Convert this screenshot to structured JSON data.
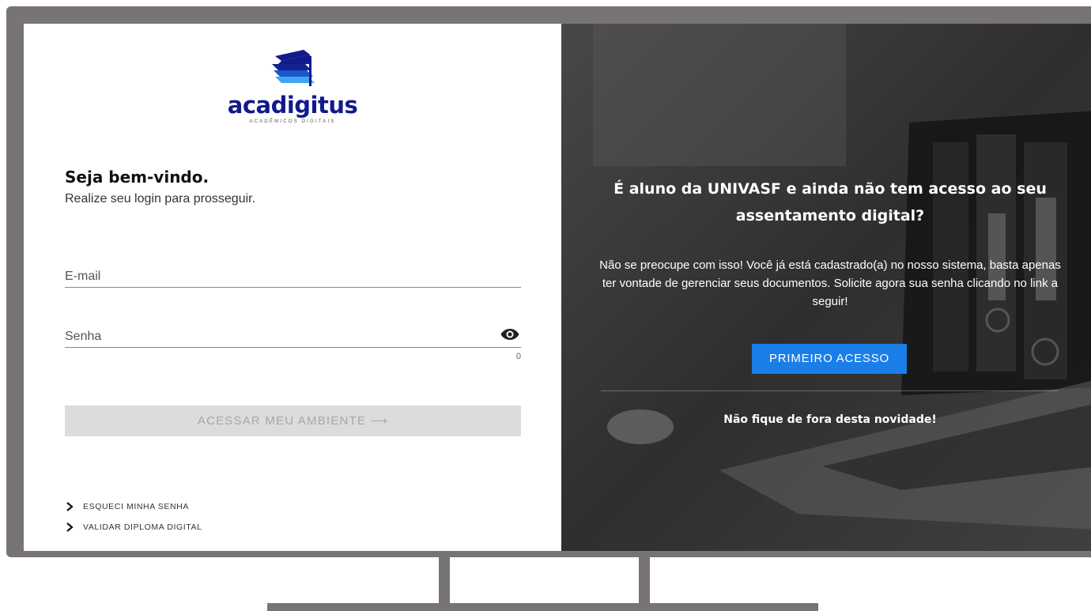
{
  "brand": {
    "name": "acadigitus",
    "tagline": "ACADÊMICOS DIGITAIS",
    "primary_color": "#111a8c",
    "accent_color": "#2f8fe8"
  },
  "login": {
    "title": "Seja bem-vindo.",
    "subtitle": "Realize seu login para prosseguir.",
    "email_placeholder": "E-mail",
    "password_placeholder": "Senha",
    "password_char_count": "0",
    "submit_label": "ACESSAR MEU AMBIENTE ⟶",
    "links": [
      {
        "label": "ESQUECI MINHA SENHA"
      },
      {
        "label": "VALIDAR DIPLOMA DIGITAL"
      }
    ]
  },
  "promo": {
    "title": "É aluno da UNIVASF e ainda não tem acesso ao seu assentamento digital?",
    "text": "Não se preocupe com isso! Você já está cadastrado(a) no nosso sistema, basta apenas ter vontade de gerenciar seus documentos. Solicite agora sua senha clicando no link a seguir!",
    "button_label": "PRIMEIRO ACESSO",
    "button_color": "#1a7ee8",
    "footer": "Não fique de fora desta novidade!"
  },
  "icons": {
    "password_toggle": "eye-icon",
    "link_marker": "chevron-right-icon"
  }
}
